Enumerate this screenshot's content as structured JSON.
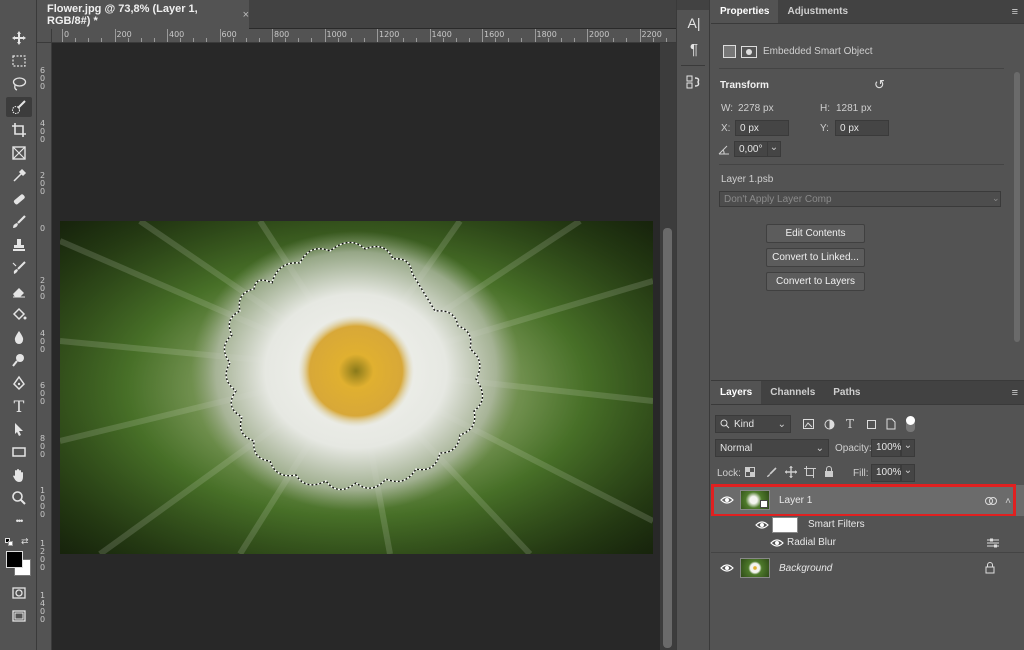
{
  "document": {
    "tab_title": "Flower.jpg @ 73,8% (Layer 1, RGB/8#) *",
    "close_glyph": "×"
  },
  "ruler_top_labels": [
    "0",
    "200",
    "400",
    "600",
    "800",
    "1000",
    "1200",
    "1400",
    "1600",
    "1800",
    "2000",
    "2200"
  ],
  "ruler_left_labels": [
    "600",
    "400",
    "200",
    "0",
    "200",
    "400",
    "600",
    "800",
    "1000",
    "1200",
    "1400"
  ],
  "toolbar": {
    "tools": [
      "move-icon",
      "marquee-icon",
      "lasso-icon",
      "quick-selection-icon",
      "crop-icon",
      "frame-icon",
      "eyedropper-icon",
      "healing-brush-icon",
      "brush-icon",
      "clone-stamp-icon",
      "history-brush-icon",
      "eraser-icon",
      "paint-bucket-icon",
      "blur-icon",
      "dodge-icon",
      "pen-icon",
      "type-icon",
      "path-selection-icon",
      "rectangle-icon",
      "hand-icon",
      "zoom-icon",
      "more-tools-icon"
    ],
    "type_glyph": "T",
    "more_glyph": "•••"
  },
  "mid_strip": {
    "char_glyph": "A|",
    "para_glyph": "¶"
  },
  "properties": {
    "tabs": [
      "Properties",
      "Adjustments"
    ],
    "object_type": "Embedded Smart Object",
    "transform_title": "Transform",
    "w_label": "W:",
    "w_value": "2278 px",
    "h_label": "H:",
    "h_value": "1281 px",
    "x_label": "X:",
    "x_value": "0 px",
    "y_label": "Y:",
    "y_value": "0 px",
    "angle_value": "0,00°",
    "filename": "Layer 1.psb",
    "layer_comp_placeholder": "Don't Apply Layer Comp",
    "buttons": [
      "Edit Contents",
      "Convert to Linked...",
      "Convert to Layers"
    ]
  },
  "layers_panel": {
    "tabs": [
      "Layers",
      "Channels",
      "Paths"
    ],
    "filter_kind": "Kind",
    "blend_mode": "Normal",
    "opacity_label": "Opacity:",
    "opacity_value": "100%",
    "lock_label": "Lock:",
    "fill_label": "Fill:",
    "fill_value": "100%",
    "layers": [
      {
        "name": "Layer 1",
        "selected": true
      },
      {
        "name": "Smart Filters"
      },
      {
        "name": "Radial Blur"
      },
      {
        "name": "Background"
      }
    ]
  },
  "colors": {
    "panel_bg": "#535353",
    "canvas_bg": "#282828",
    "highlight_border": "#e02020",
    "selected_layer": "#6b6b6b"
  }
}
